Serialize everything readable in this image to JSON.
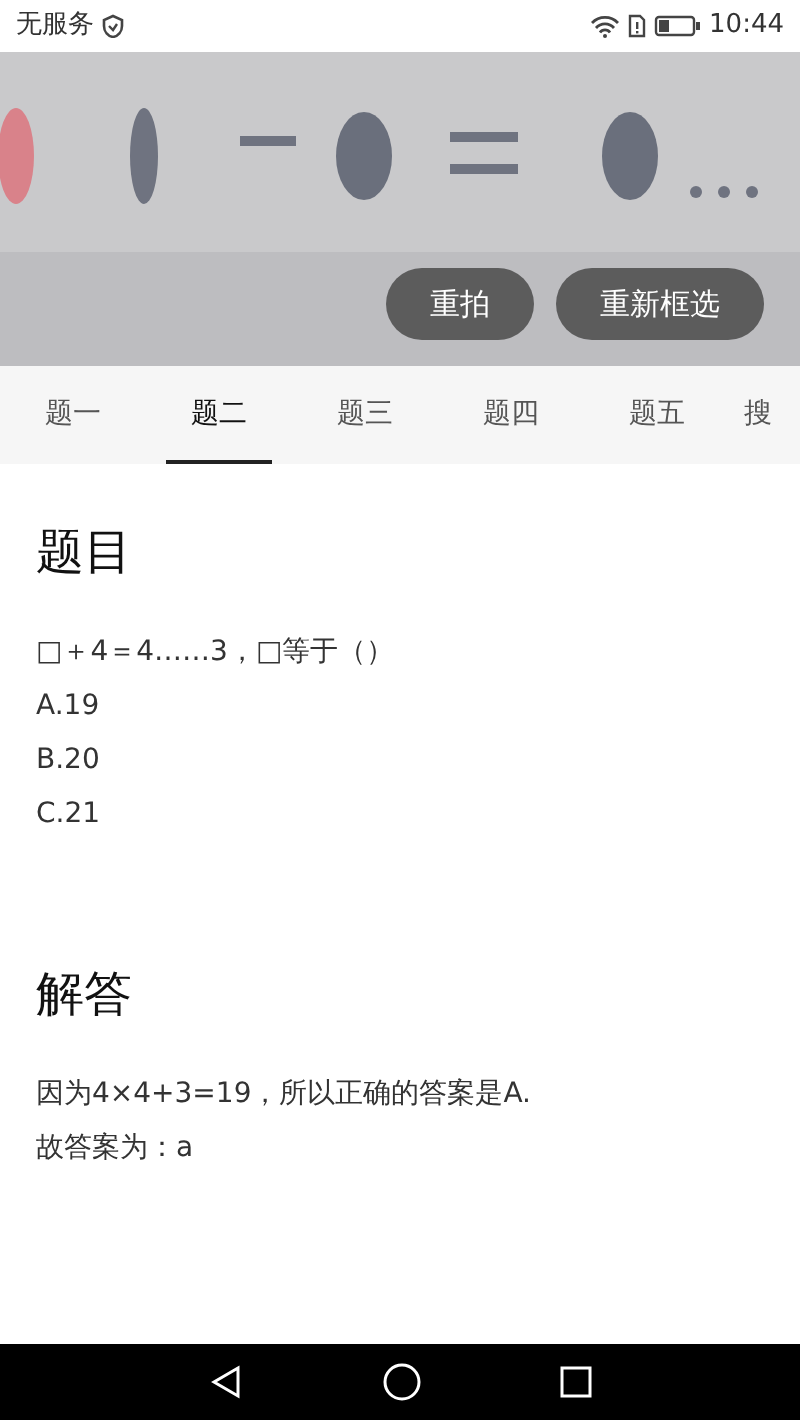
{
  "status_bar": {
    "carrier": "无服务",
    "time": "10:44"
  },
  "photo": {
    "kind": "picture",
    "buttons": [
      "重拍",
      "重新框选"
    ]
  },
  "tabs": [
    {
      "label": "题一",
      "selected": false
    },
    {
      "label": "题二",
      "selected": true
    },
    {
      "label": "题三",
      "selected": false
    },
    {
      "label": "题四",
      "selected": false
    },
    {
      "label": "题五",
      "selected": false
    },
    {
      "label": "搜",
      "selected": false
    }
  ],
  "question": {
    "heading": "题目",
    "lines": [
      "□＋4＝4……3，□等于（）",
      "A.19",
      "B.20",
      "C.21"
    ]
  },
  "answer": {
    "heading": "解答",
    "lines": [
      "因为4×4+3=19，所以正确的答案是A.",
      "故答案为：a"
    ]
  }
}
